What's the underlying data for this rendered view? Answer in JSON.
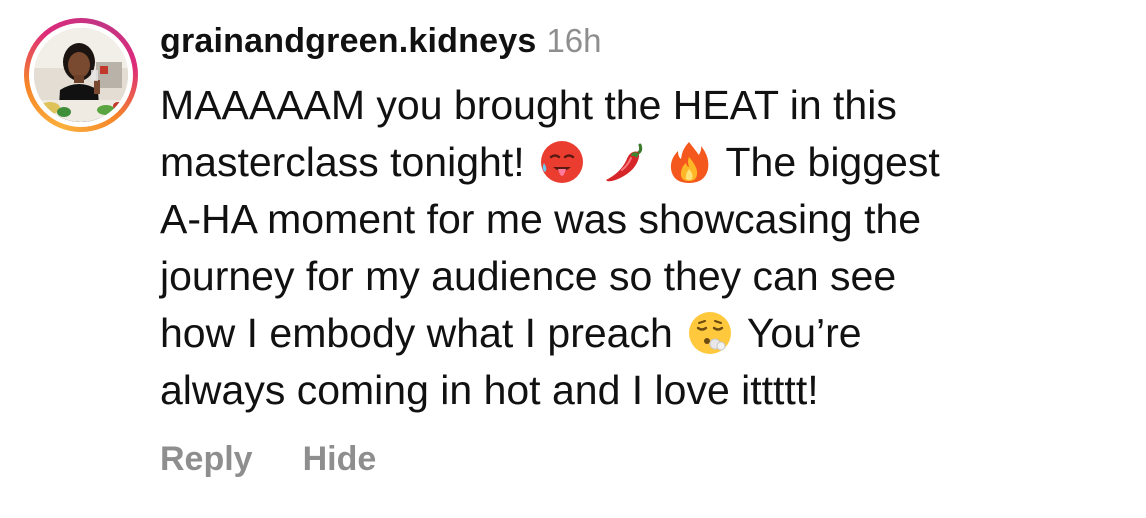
{
  "comment": {
    "username": "grainandgreen.kidneys",
    "timestamp": "16h",
    "text_segments": {
      "l1": "MAAAAAM you brought the HEAT in this",
      "l2a": "masterclass tonight!",
      "l2b": "The biggest",
      "l3": "A-HA moment for me was showcasing the",
      "l4": "journey for my audience so they can see",
      "l5a": "how I embody what I preach",
      "l5b": "You’re",
      "l6": "always coming in hot and I love ittttt!"
    },
    "emojis": [
      "hot-face",
      "hot-pepper",
      "fire",
      "face-exhaling"
    ],
    "actions": {
      "reply": "Reply",
      "hide": "Hide"
    }
  },
  "colors": {
    "text": "#111111",
    "muted": "#8e8e8e",
    "ring_start": "#fbb03b",
    "ring_end": "#c13584"
  }
}
